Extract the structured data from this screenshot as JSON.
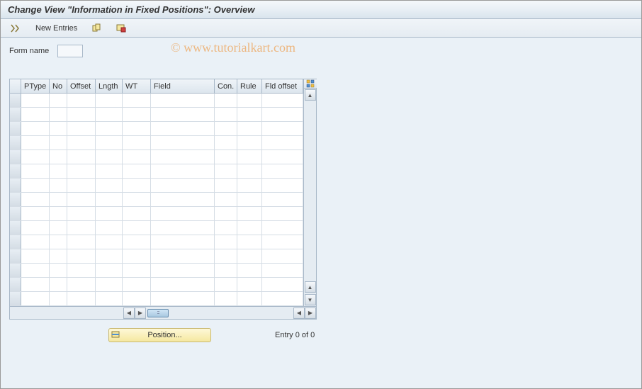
{
  "title": "Change View \"Information in Fixed Positions\": Overview",
  "toolbar": {
    "new_entries": "New Entries"
  },
  "form": {
    "name_label": "Form name",
    "name_value": ""
  },
  "grid": {
    "columns": {
      "ptype": "PType",
      "no": "No",
      "offset": "Offset",
      "lngth": "Lngth",
      "wt": "WT",
      "field": "Field",
      "con": "Con.",
      "rule": "Rule",
      "fldoffset": "Fld offset"
    },
    "row_count": 15
  },
  "footer": {
    "position_label": "Position...",
    "entry_text": "Entry 0 of 0"
  },
  "watermark": "© www.tutorialkart.com"
}
